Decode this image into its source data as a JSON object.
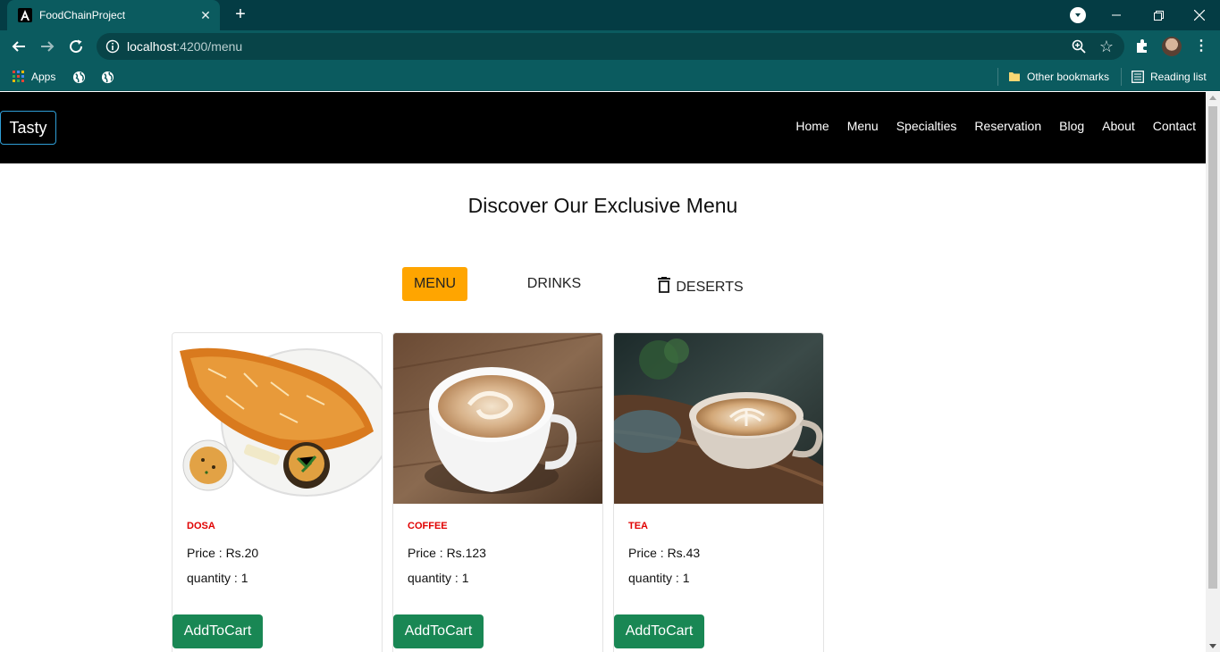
{
  "browser": {
    "tab_title": "FoodChainProject",
    "url_host": "localhost",
    "url_path": ":4200/menu",
    "bookmarks": {
      "apps_label": "Apps",
      "other_bookmarks": "Other bookmarks",
      "reading_list": "Reading list"
    }
  },
  "site": {
    "brand": "Tasty",
    "nav": [
      "Home",
      "Menu",
      "Specialties",
      "Reservation",
      "Blog",
      "About",
      "Contact"
    ]
  },
  "menu": {
    "heading": "Discover Our Exclusive Menu",
    "filters": [
      {
        "label": "MENU",
        "active": true
      },
      {
        "label": "DRINKS",
        "active": false
      },
      {
        "label": "DESERTS",
        "active": false
      }
    ],
    "items": [
      {
        "name": "DOSA",
        "price_label": "Price : Rs.20",
        "quantity_label": "quantity : 1",
        "button": "AddToCart"
      },
      {
        "name": "COFFEE",
        "price_label": "Price : Rs.123",
        "quantity_label": "quantity : 1",
        "button": "AddToCart"
      },
      {
        "name": "TEA",
        "price_label": "Price : Rs.43",
        "quantity_label": "quantity : 1",
        "button": "AddToCart"
      }
    ]
  },
  "colors": {
    "chrome_dark": "#043c44",
    "chrome": "#0b5b5f",
    "nav_bg": "#000000",
    "active_filter": "#ffa500",
    "item_name": "#e00000",
    "cart_button": "#198754"
  }
}
